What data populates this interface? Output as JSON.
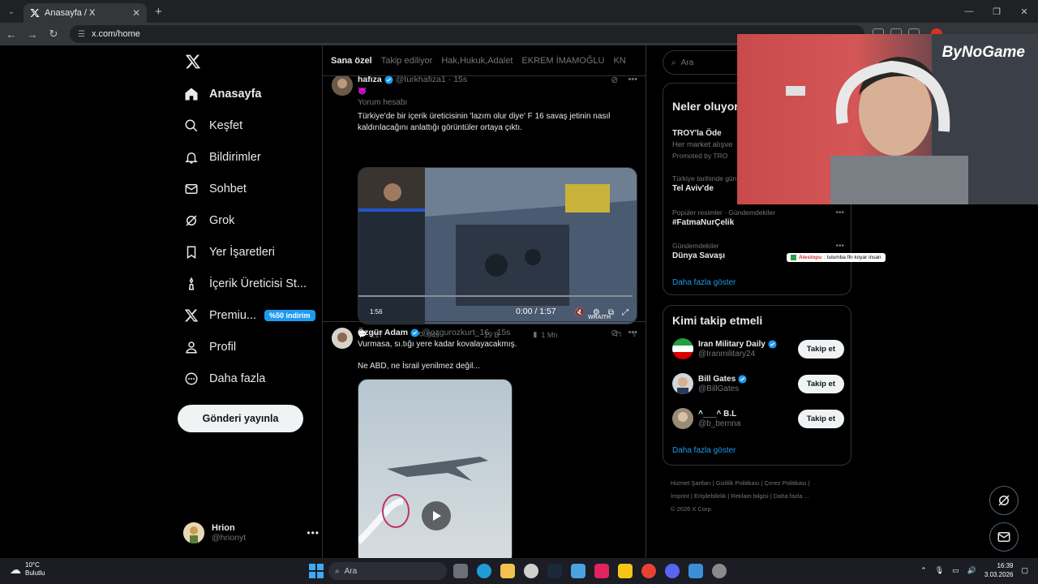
{
  "browser": {
    "tab_title": "Anasayfa / X",
    "url": "x.com/home"
  },
  "sidebar": {
    "items": [
      {
        "label": "Anasayfa",
        "icon": "home-icon"
      },
      {
        "label": "Keşfet",
        "icon": "search-icon"
      },
      {
        "label": "Bildirimler",
        "icon": "bell-icon"
      },
      {
        "label": "Sohbet",
        "icon": "mail-icon"
      },
      {
        "label": "Grok",
        "icon": "grok-icon"
      },
      {
        "label": "Yer İşaretleri",
        "icon": "bookmark-icon"
      },
      {
        "label": "İçerik Üreticisi St...",
        "icon": "creator-icon"
      },
      {
        "label": "Premiu...",
        "icon": "x-premium-icon",
        "badge": "%50 indirim"
      },
      {
        "label": "Profil",
        "icon": "person-icon"
      },
      {
        "label": "Daha fazla",
        "icon": "more-circle-icon"
      }
    ],
    "post_button": "Gönderi yayınla",
    "account": {
      "name": "Hrion",
      "handle": "@hrionyt"
    }
  },
  "timeline": {
    "tabs": [
      "Sana özel",
      "Takip ediliyor",
      "Hak,Hukuk,Adalet",
      "EKREM İMAMOĞLU",
      "KN"
    ],
    "tweets": [
      {
        "name": "hafıza",
        "handle": "@turkhafiza1",
        "time": "· 15s",
        "subtitle": "Yorum hesabı",
        "text": "Türkiye'de bir içerik üreticisinin 'lazım olur diye' F 16 savaş jetinin nasıl kaldırılacağını anlattığı görüntüler ortaya çıktı.",
        "video_time": "0:00 / 1:57",
        "video_thumb_label": "1:56",
        "watermark": "WRAITH",
        "stats": {
          "replies": "217",
          "reposts": "949",
          "likes": "19 B",
          "views": "1 Mn"
        }
      },
      {
        "name": "Özgür Adam",
        "handle": "@ozgurozkurt_16",
        "time": "· 15s",
        "text_line1": "Vurmasa, sı.tığı yere kadar kovalayacakmış.",
        "text_line2": "Ne ABD, ne İsrail yenilmez değil..."
      }
    ]
  },
  "right": {
    "search_placeholder": "Ara",
    "trends_title": "Neler oluyor",
    "trends": [
      {
        "meta": "",
        "title": "TROY'la Öde",
        "desc": "Her market alışve",
        "promo": "Promoted by TRO"
      },
      {
        "meta": "Türkiye tarihinde gün",
        "title": "Tel Aviv'de"
      },
      {
        "meta": "Popüler resimler · Gündemdekiler",
        "title": "#FatmaNurÇelik"
      },
      {
        "meta": "Gündemdekiler",
        "title": "Dünya Savaşı"
      }
    ],
    "trends_more": "Daha fazla göster",
    "who_title": "Kimi takip etmeli",
    "who": [
      {
        "name": "Iran Military Daily",
        "handle": "@Iranmilitary24",
        "button": "Takip et"
      },
      {
        "name": "Bill Gates",
        "handle": "@BillGates",
        "button": "Takip et"
      },
      {
        "name": "^___^ B.L",
        "handle": "@b_bernna",
        "button": "Takip et"
      }
    ],
    "who_more": "Daha fazla göster",
    "footer": [
      "Hizmet Şartları",
      "Gizlilik Politikası",
      "Çerez Politikası",
      "İmprint",
      "Erişilebilirlik",
      "Reklam bilgisi",
      "Daha fazla ...",
      "© 2026 X Corp."
    ]
  },
  "overlay": {
    "brand": "ByNoGame",
    "chat_user": "Atestopu",
    "chat_msg": ": tulumba fln koyar insan"
  },
  "taskbar": {
    "temp": "10°C",
    "weather": "Bulutlu",
    "search": "Ara",
    "time": "16:39",
    "date": "3.03.2026"
  }
}
